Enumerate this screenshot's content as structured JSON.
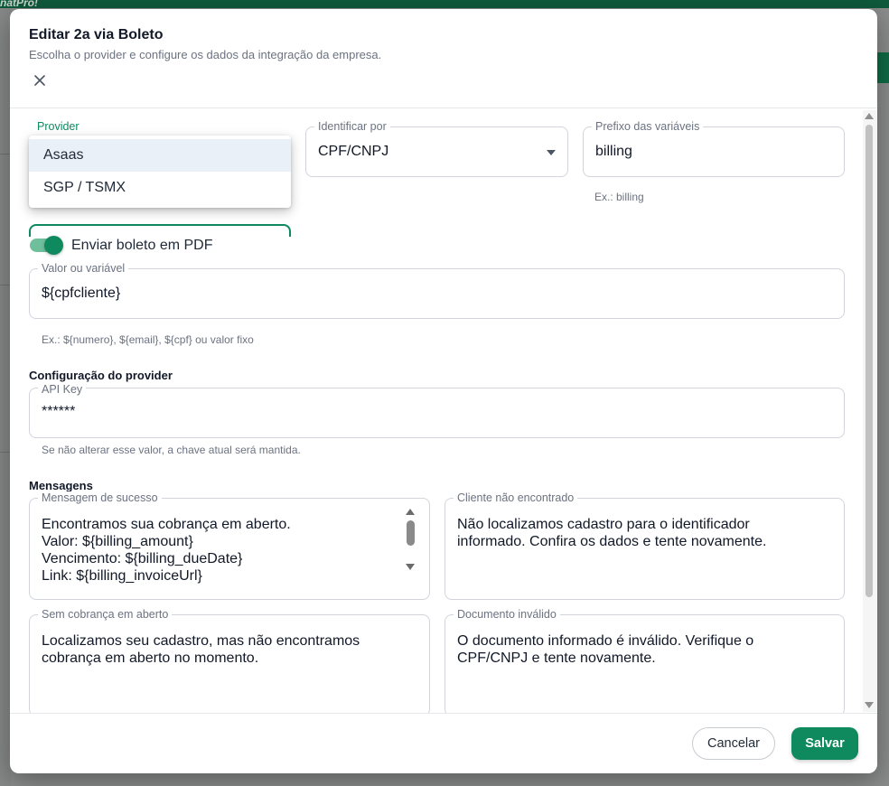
{
  "background": {
    "logo": "natPro!"
  },
  "modal": {
    "title": "Editar 2a via Boleto",
    "subtitle": "Escolha o provider e configure os dados da integração da empresa.",
    "close_icon": "close-icon"
  },
  "provider": {
    "label": "Provider",
    "options": [
      "Asaas",
      "SGP / TSMX"
    ],
    "selected": "Asaas"
  },
  "identificar": {
    "label": "Identificar por",
    "value": "CPF/CNPJ"
  },
  "prefixo": {
    "label": "Prefixo das variáveis",
    "value": "billing",
    "helper": "Ex.: billing"
  },
  "pdf_toggle": {
    "label": "Enviar boleto em PDF",
    "checked": true
  },
  "valor": {
    "label": "Valor ou variável",
    "value": "${cpfcliente}",
    "helper": "Ex.: ${numero}, ${email}, ${cpf} ou valor fixo"
  },
  "config_provider": {
    "title": "Configuração do provider",
    "api_key": {
      "label": "API Key",
      "value": "******",
      "helper": "Se não alterar esse valor, a chave atual será mantida."
    }
  },
  "mensagens": {
    "title": "Mensagens",
    "sucesso": {
      "label": "Mensagem de sucesso",
      "value": "Encontramos sua cobrança em aberto.\nValor: ${billing_amount}\nVencimento: ${billing_dueDate}\nLink: ${billing_invoiceUrl}"
    },
    "cliente_nao_encontrado": {
      "label": "Cliente não encontrado",
      "value": "Não localizamos cadastro para o identificador\ninformado. Confira os dados e tente novamente."
    },
    "sem_cobranca": {
      "label": "Sem cobrança em aberto",
      "value": "Localizamos seu cadastro, mas não encontramos\ncobrança em aberto no momento."
    },
    "documento_invalido": {
      "label": "Documento inválido",
      "value": "O documento informado é inválido. Verifique o\nCPF/CNPJ e tente novamente."
    }
  },
  "footer": {
    "cancel_label": "Cancelar",
    "save_label": "Salvar"
  },
  "colors": {
    "primary": "#0f8a5f",
    "toggle_track": "#6fbf9c",
    "selected_option_bg": "#eaf0f7"
  }
}
